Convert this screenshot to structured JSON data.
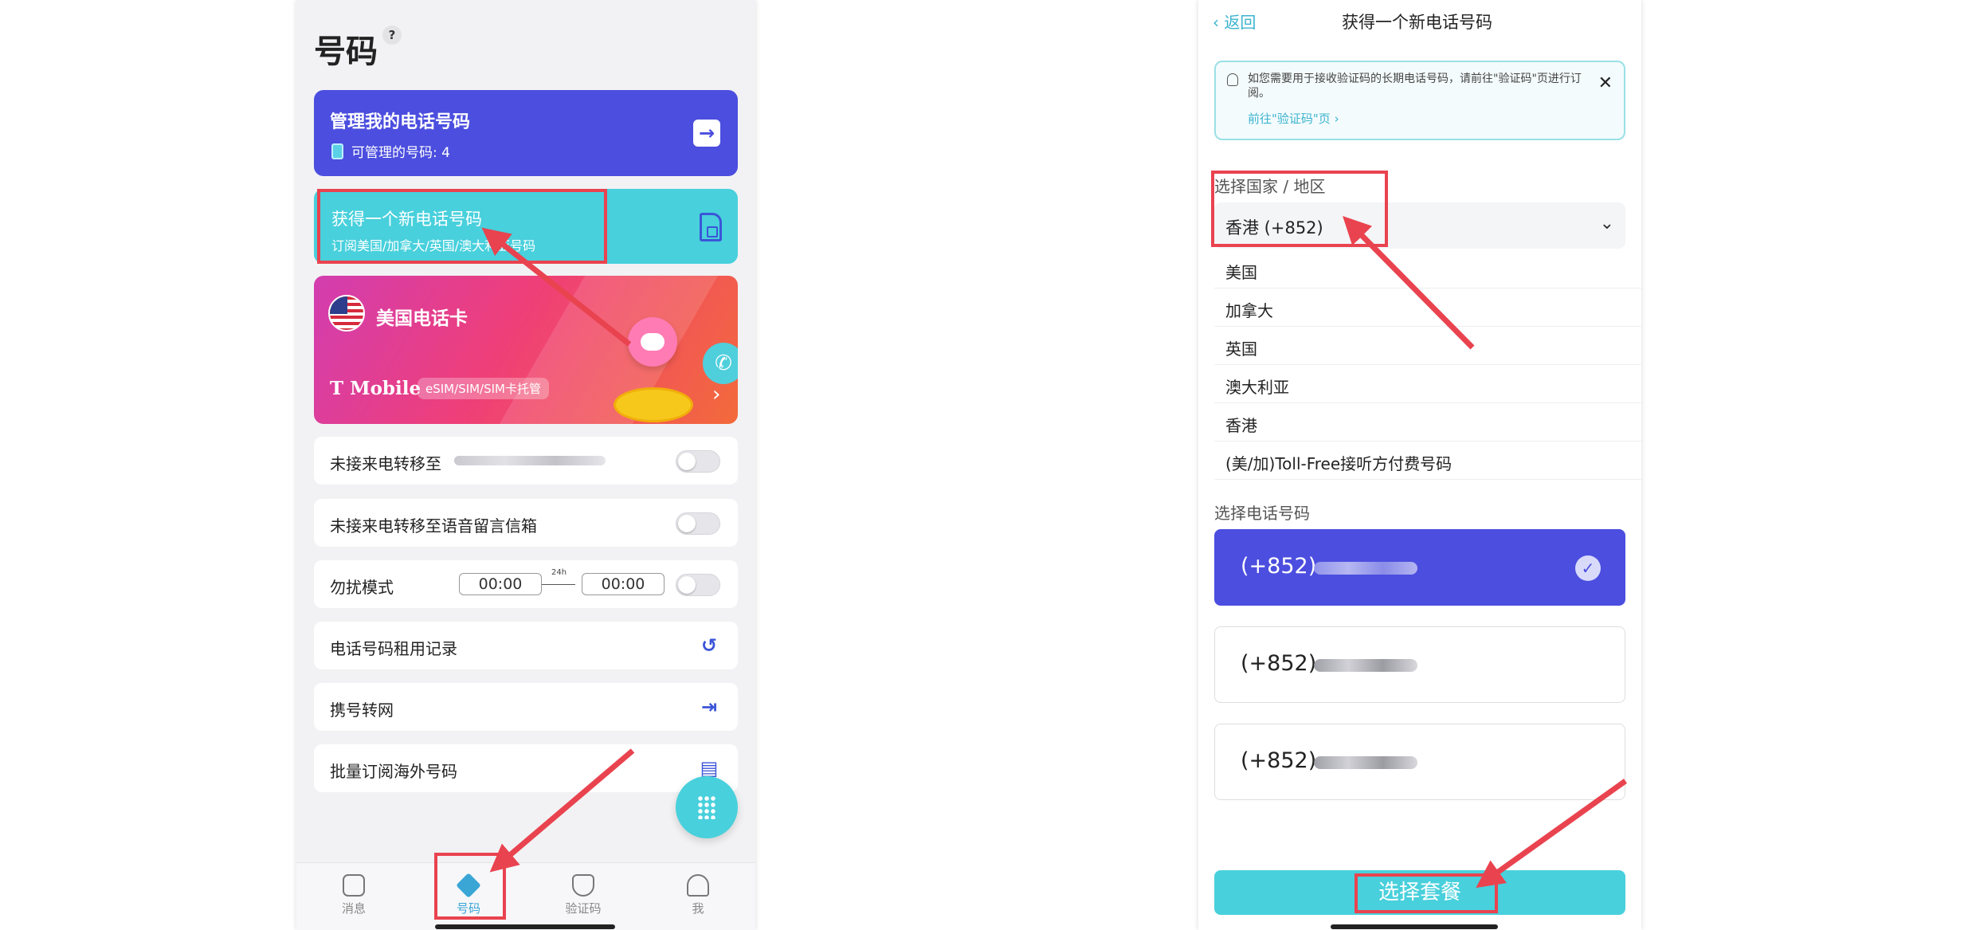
{
  "left": {
    "title": "号码",
    "help": "?",
    "manage_card": {
      "title": "管理我的电话号码",
      "sub": "可管理的号码: 4"
    },
    "new_card": {
      "title": "获得一个新电话号码",
      "sub": "订阅美国/加拿大/英国/澳大利亚号码"
    },
    "tmobile_card": {
      "title": "美国电话卡",
      "brand": "T Mobile",
      "badge": "eSIM/SIM/SIM卡托管"
    },
    "rows": {
      "forward": "未接来电转移至",
      "voicemail": "未接来电转移至语音留言信箱",
      "dnd": "勿扰模式",
      "dnd_start": "00:00",
      "dnd_end": "00:00",
      "dnd_24h": "24h",
      "history": "电话号码租用记录",
      "transfer": "携号转网",
      "bulk": "批量订阅海外号码"
    },
    "tabs": {
      "messages": "消息",
      "numbers": "号码",
      "codes": "验证码",
      "me": "我"
    }
  },
  "right": {
    "back": "返回",
    "title": "获得一个新电话号码",
    "notice": {
      "text": "如您需要用于接收验证码的长期电话号码，请前往\"验证码\"页进行订阅。",
      "link": "前往\"验证码\"页"
    },
    "country_label": "选择国家 / 地区",
    "country_selected": "香港 (+852)",
    "country_options": [
      "美国",
      "加拿大",
      "英国",
      "澳大利亚",
      "香港",
      "(美/加)Toll-Free接听方付费号码"
    ],
    "number_label": "选择电话号码",
    "numbers": [
      {
        "code": "(+852)",
        "selected": true
      },
      {
        "code": "(+852)",
        "selected": false
      },
      {
        "code": "(+852)",
        "selected": false
      }
    ],
    "cta": "选择套餐"
  },
  "colors": {
    "brand_blue": "#4b4ede",
    "accent_teal": "#48d0dc",
    "annotation_red": "#e9434f"
  }
}
